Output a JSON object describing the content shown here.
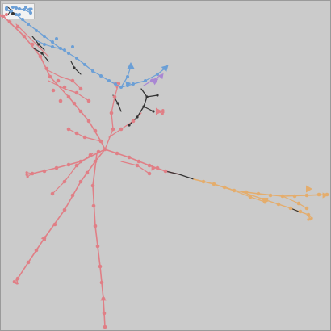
{
  "title": "",
  "colors": {
    "background": "#cbcbcb",
    "red": "#e07f86",
    "blue": "#6b9fd6",
    "orange": "#e4ad6d",
    "purple": "#a987d3",
    "dark": "#333333"
  },
  "legend": {
    "entries": []
  }
}
